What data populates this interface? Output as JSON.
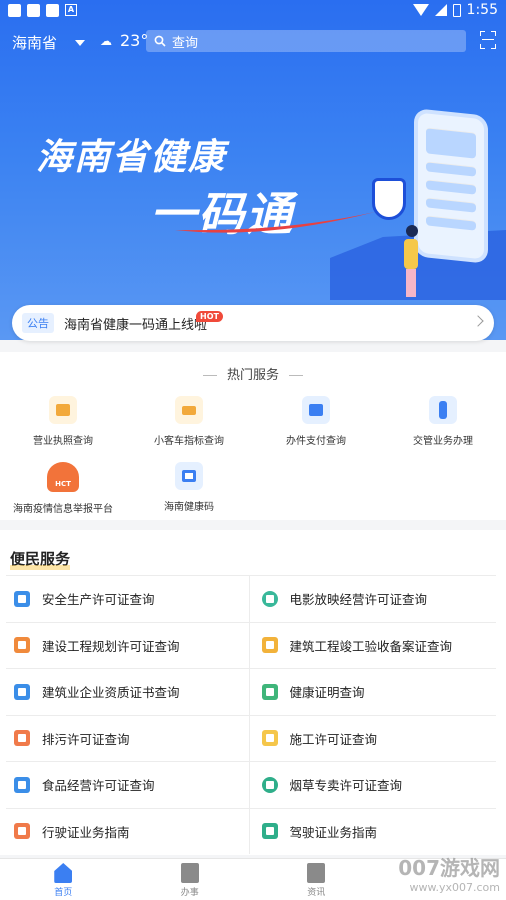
{
  "status_bar": {
    "time": "1:55"
  },
  "header": {
    "province": "海南省",
    "temperature": "23°",
    "search_placeholder": "查询"
  },
  "banner": {
    "line1": "海南省健康",
    "line2": "一码通"
  },
  "notice": {
    "tag": "公告",
    "text": "海南省健康一码通上线啦",
    "badge": "HOT"
  },
  "hot_services": {
    "title": "热门服务",
    "items": [
      {
        "label": "营业执照查询",
        "icon": "license-icon"
      },
      {
        "label": "小客车指标查询",
        "icon": "bus-icon"
      },
      {
        "label": "办件支付查询",
        "icon": "payment-icon"
      },
      {
        "label": "交管业务办理",
        "icon": "traffic-light-icon"
      },
      {
        "label": "海南疫情信息举报平台",
        "icon": "hct-icon",
        "icon_text": "HCT"
      },
      {
        "label": "海南健康码",
        "icon": "qr-code-icon"
      }
    ]
  },
  "convenience": {
    "title": "便民服务",
    "items": [
      [
        "安全生产许可证查询",
        "电影放映经营许可证查询"
      ],
      [
        "建设工程规划许可证查询",
        "建筑工程竣工验收备案证查询"
      ],
      [
        "建筑业企业资质证书查询",
        "健康证明查询"
      ],
      [
        "排污许可证查询",
        "施工许可证查询"
      ],
      [
        "食品经营许可证查询",
        "烟草专卖许可证查询"
      ],
      [
        "行驶证业务指南",
        "驾驶证业务指南"
      ]
    ]
  },
  "bottom_nav": [
    {
      "label": "首页",
      "active": true
    },
    {
      "label": "办事",
      "active": false
    },
    {
      "label": "资讯",
      "active": false
    }
  ],
  "watermark": {
    "brand": "007游戏网",
    "url": "www.yx007.com"
  },
  "colors": {
    "primary": "#3b7ff2",
    "hot_badge": "#f04a3a"
  }
}
